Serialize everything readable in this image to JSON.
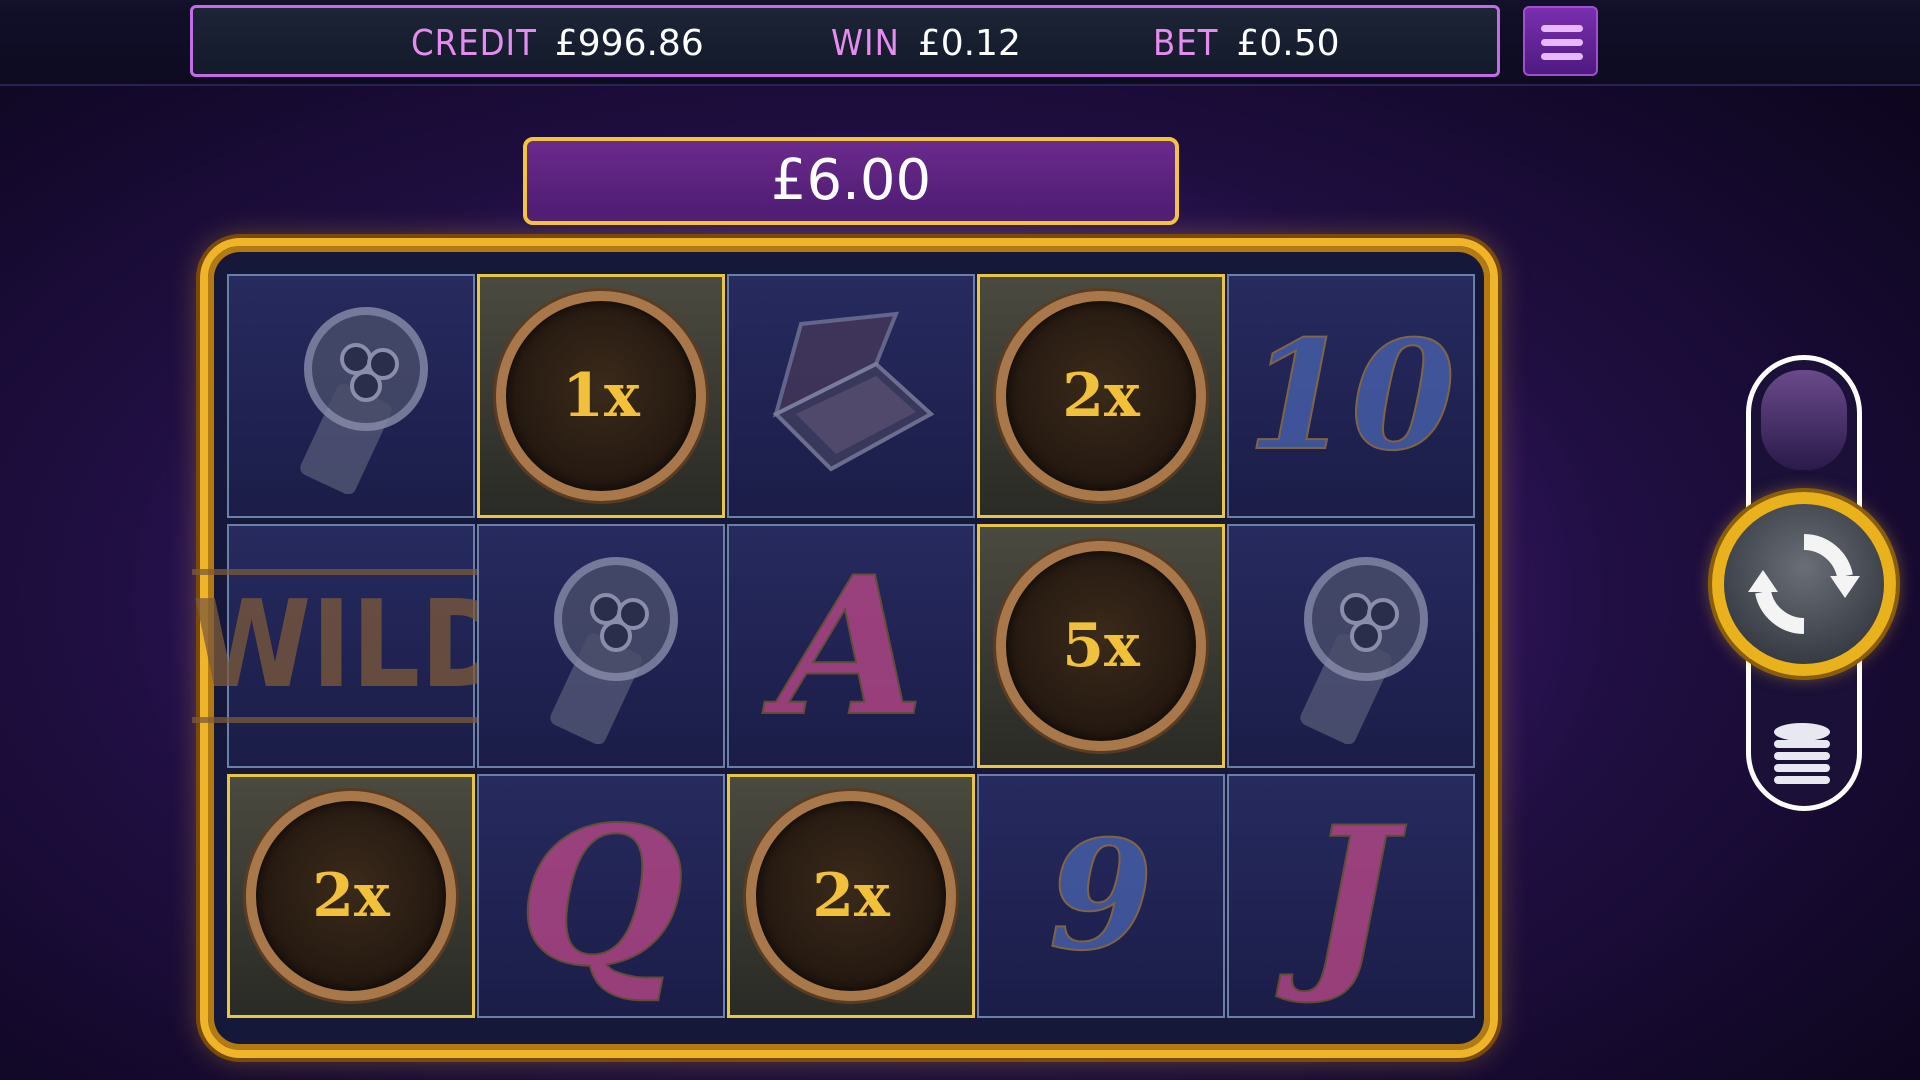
{
  "header": {
    "credit_label": "CREDIT",
    "credit_value": "£996.86",
    "win_label": "WIN",
    "win_value": "£0.12",
    "bet_label": "BET",
    "bet_value": "£0.50"
  },
  "total_win": "£6.00",
  "reels": [
    [
      {
        "kind": "watch"
      },
      {
        "kind": "multiplier",
        "text": "1x"
      },
      {
        "kind": "briefcase"
      },
      {
        "kind": "multiplier",
        "text": "2x"
      },
      {
        "kind": "number",
        "text": "10"
      }
    ],
    [
      {
        "kind": "wild",
        "text": "WILD"
      },
      {
        "kind": "watch"
      },
      {
        "kind": "letter",
        "text": "A"
      },
      {
        "kind": "multiplier",
        "text": "5x"
      },
      {
        "kind": "watch"
      }
    ],
    [
      {
        "kind": "multiplier",
        "text": "2x"
      },
      {
        "kind": "letter",
        "text": "Q"
      },
      {
        "kind": "multiplier",
        "text": "2x"
      },
      {
        "kind": "number",
        "text": "9"
      },
      {
        "kind": "letter",
        "text": "J"
      }
    ]
  ],
  "icons": {
    "menu": "hamburger-menu-icon",
    "spin": "spin-arrows-icon",
    "coins": "coin-stack-icon",
    "watch": "wristwatch-icon",
    "briefcase": "briefcase-icon"
  },
  "colors": {
    "accent_purple": "#c46be8",
    "gold": "#f0b429",
    "label_pink": "#e58cf0"
  }
}
